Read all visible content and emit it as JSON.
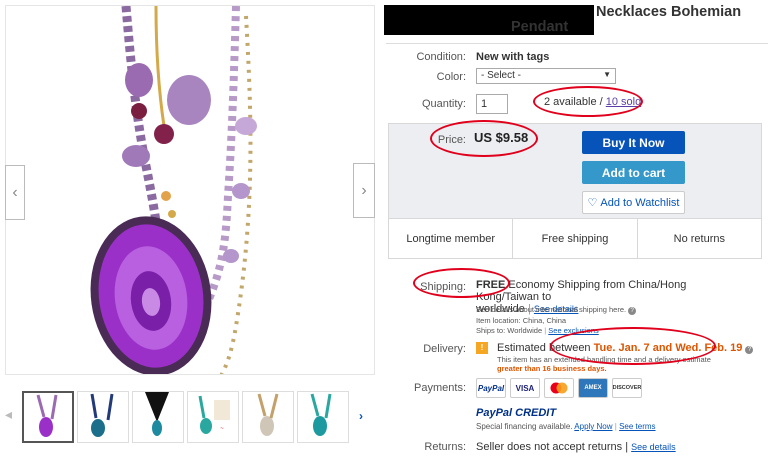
{
  "title": {
    "text_line1": "Necklaces Bohemian",
    "text_line2": "Pendant"
  },
  "condition": {
    "label": "Condition:",
    "value": "New with tags"
  },
  "color": {
    "label": "Color:",
    "selected": "- Select -"
  },
  "quantity": {
    "label": "Quantity:",
    "value": "1",
    "available": "2 available",
    "separator": " / ",
    "sold": "10 sold"
  },
  "price": {
    "label": "Price:",
    "value": "US $9.58"
  },
  "buttons": {
    "buy_now": "Buy It Now",
    "add_to_cart": "Add to cart",
    "watchlist": "Add to Watchlist"
  },
  "features": [
    "Longtime member",
    "Free shipping",
    "No returns"
  ],
  "shipping": {
    "label": "Shipping:",
    "free": "FREE",
    "method_a": "Economy Shipping from China/Hong Kong/Taiwan to",
    "method_b": "worldwide",
    "see_details": "See details",
    "intl_note": "See details about international shipping here.",
    "item_location": "Item location:  China, China",
    "ships_to": "Ships to:  Worldwide",
    "see_exclusions": "See exclusions"
  },
  "delivery": {
    "label": "Delivery:",
    "estimated": "Estimated between",
    "dates": "Tue. Jan. 7 and Wed. Feb. 19",
    "note": "This item has an extended handling time and a delivery estimate",
    "note2": "greater than 16 business days."
  },
  "payments": {
    "label": "Payments:",
    "methods": [
      "PayPal",
      "VISA",
      "MC",
      "AMEX",
      "DISCOVER"
    ],
    "credit": "PayPal CREDIT",
    "special": "Special financing available.",
    "apply": "Apply Now",
    "terms": "See terms"
  },
  "returns": {
    "label": "Returns:",
    "value": "Seller does not accept returns",
    "separator": " | ",
    "see_details": "See details"
  },
  "colors": {
    "accent": "#0654ba",
    "annotation": "#e0001b",
    "delivery_date": "#dd5500"
  }
}
